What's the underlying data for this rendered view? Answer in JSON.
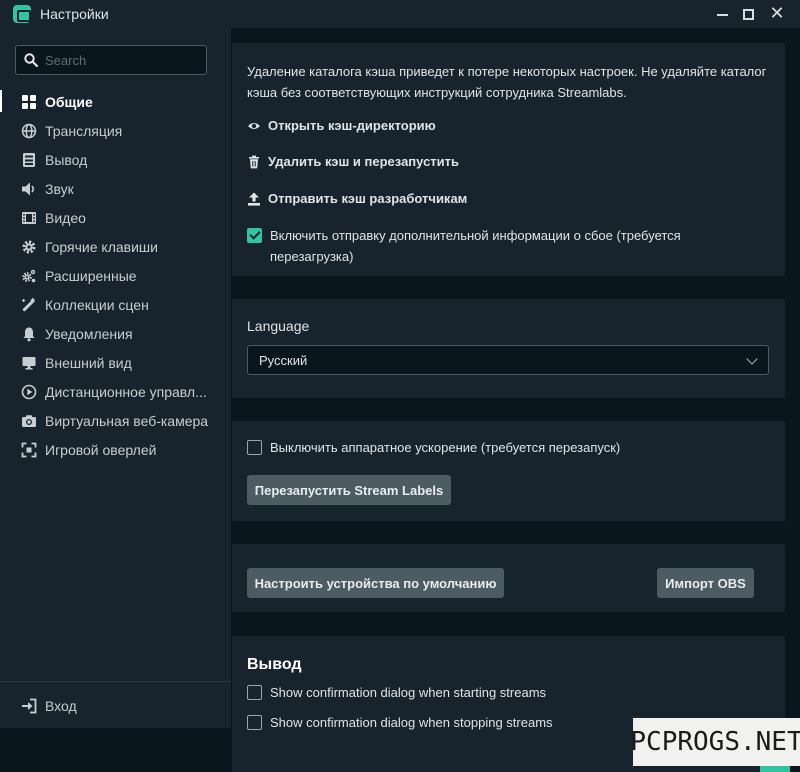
{
  "window": {
    "title": "Настройки",
    "controls": [
      "minimize",
      "maximize",
      "close"
    ]
  },
  "sidebar": {
    "search_placeholder": "Search",
    "items": [
      {
        "label": "Общие",
        "icon": "grid-icon",
        "active": true
      },
      {
        "label": "Трансляция",
        "icon": "globe-icon"
      },
      {
        "label": "Вывод",
        "icon": "output-icon"
      },
      {
        "label": "Звук",
        "icon": "speaker-icon"
      },
      {
        "label": "Видео",
        "icon": "film-icon"
      },
      {
        "label": "Горячие клавиши",
        "icon": "gear-icon"
      },
      {
        "label": "Расширенные",
        "icon": "gears-icon"
      },
      {
        "label": "Коллекции сцен",
        "icon": "magic-wand-icon"
      },
      {
        "label": "Уведомления",
        "icon": "bell-icon"
      },
      {
        "label": "Внешний вид",
        "icon": "monitor-icon"
      },
      {
        "label": "Дистанционное управл...",
        "icon": "play-circle-icon"
      },
      {
        "label": "Виртуальная веб-камера",
        "icon": "camera-icon"
      },
      {
        "label": "Игровой оверлей",
        "icon": "expand-icon"
      }
    ],
    "login_label": "Вход"
  },
  "cache_card": {
    "warning": "Удаление каталога кэша приведет к потере некоторых настроек. Не удаляйте каталог кэша без соответствующих инструкций сотрудника Streamlabs.",
    "open_cache": "Открыть кэш-директорию",
    "delete_cache": "Удалить кэш и перезапустить",
    "upload_cache": "Отправить кэш разработчикам",
    "crash_report_label": "Включить отправку дополнительной информации о сбое (требуется перезагрузка)",
    "crash_report_checked": true
  },
  "language_card": {
    "label": "Language",
    "selected": "Русский"
  },
  "hardware_card": {
    "disable_hw_label": "Выключить аппаратное ускорение (требуется перезапуск)",
    "disable_hw_checked": false,
    "restart_labels_button": "Перезапустить Stream Labels"
  },
  "devices_card": {
    "configure_devices_button": "Настроить устройства по умолчанию",
    "import_obs_button": "Импорт OBS"
  },
  "output_card": {
    "title": "Вывод",
    "confirm_start_label": "Show confirmation dialog when starting streams",
    "confirm_stop_label": "Show confirmation dialog when stopping streams"
  },
  "watermark": "PCPROGS.NET",
  "colors": {
    "background": "#09161d",
    "panel": "#17242d",
    "accent": "#31c3a2",
    "button": "#4d5b63"
  }
}
